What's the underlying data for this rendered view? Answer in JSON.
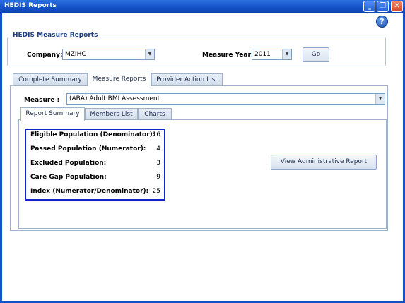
{
  "window": {
    "title": "HEDIS Reports"
  },
  "group": {
    "legend": "HEDIS Measure Reports"
  },
  "filters": {
    "company_label": "Company:",
    "company_value": "MZIHC",
    "year_label": "Measure Year:",
    "year_value": "2011",
    "go_label": "Go"
  },
  "main_tabs": [
    {
      "label": "Complete Summary",
      "active": false
    },
    {
      "label": "Measure Reports",
      "active": true
    },
    {
      "label": "Provider Action List",
      "active": false
    }
  ],
  "measure": {
    "label": "Measure :",
    "value": "(ABA) Adult BMI Assessment"
  },
  "sub_tabs": [
    {
      "label": "Report Summary",
      "active": true
    },
    {
      "label": "Members List",
      "active": false
    },
    {
      "label": "Charts",
      "active": false
    }
  ],
  "stats": [
    {
      "label": "Eligible Population (Denominator):",
      "value": "16"
    },
    {
      "label": "Passed Population (Numerator):",
      "value": "4"
    },
    {
      "label": "Excluded Population:",
      "value": "3"
    },
    {
      "label": "Care Gap Population:",
      "value": "9"
    },
    {
      "label": "Index (Numerator/Denominator):",
      "value": "25"
    }
  ],
  "admin_report_button": "View Administrative Report",
  "icons": {
    "minimize": "minimize-icon",
    "restore": "restore-icon",
    "close": "close-icon",
    "help": "help-icon",
    "dropdown": "chevron-down-icon"
  },
  "colors": {
    "titlebar": "#1451c8",
    "highlight_box": "#1224c8"
  }
}
